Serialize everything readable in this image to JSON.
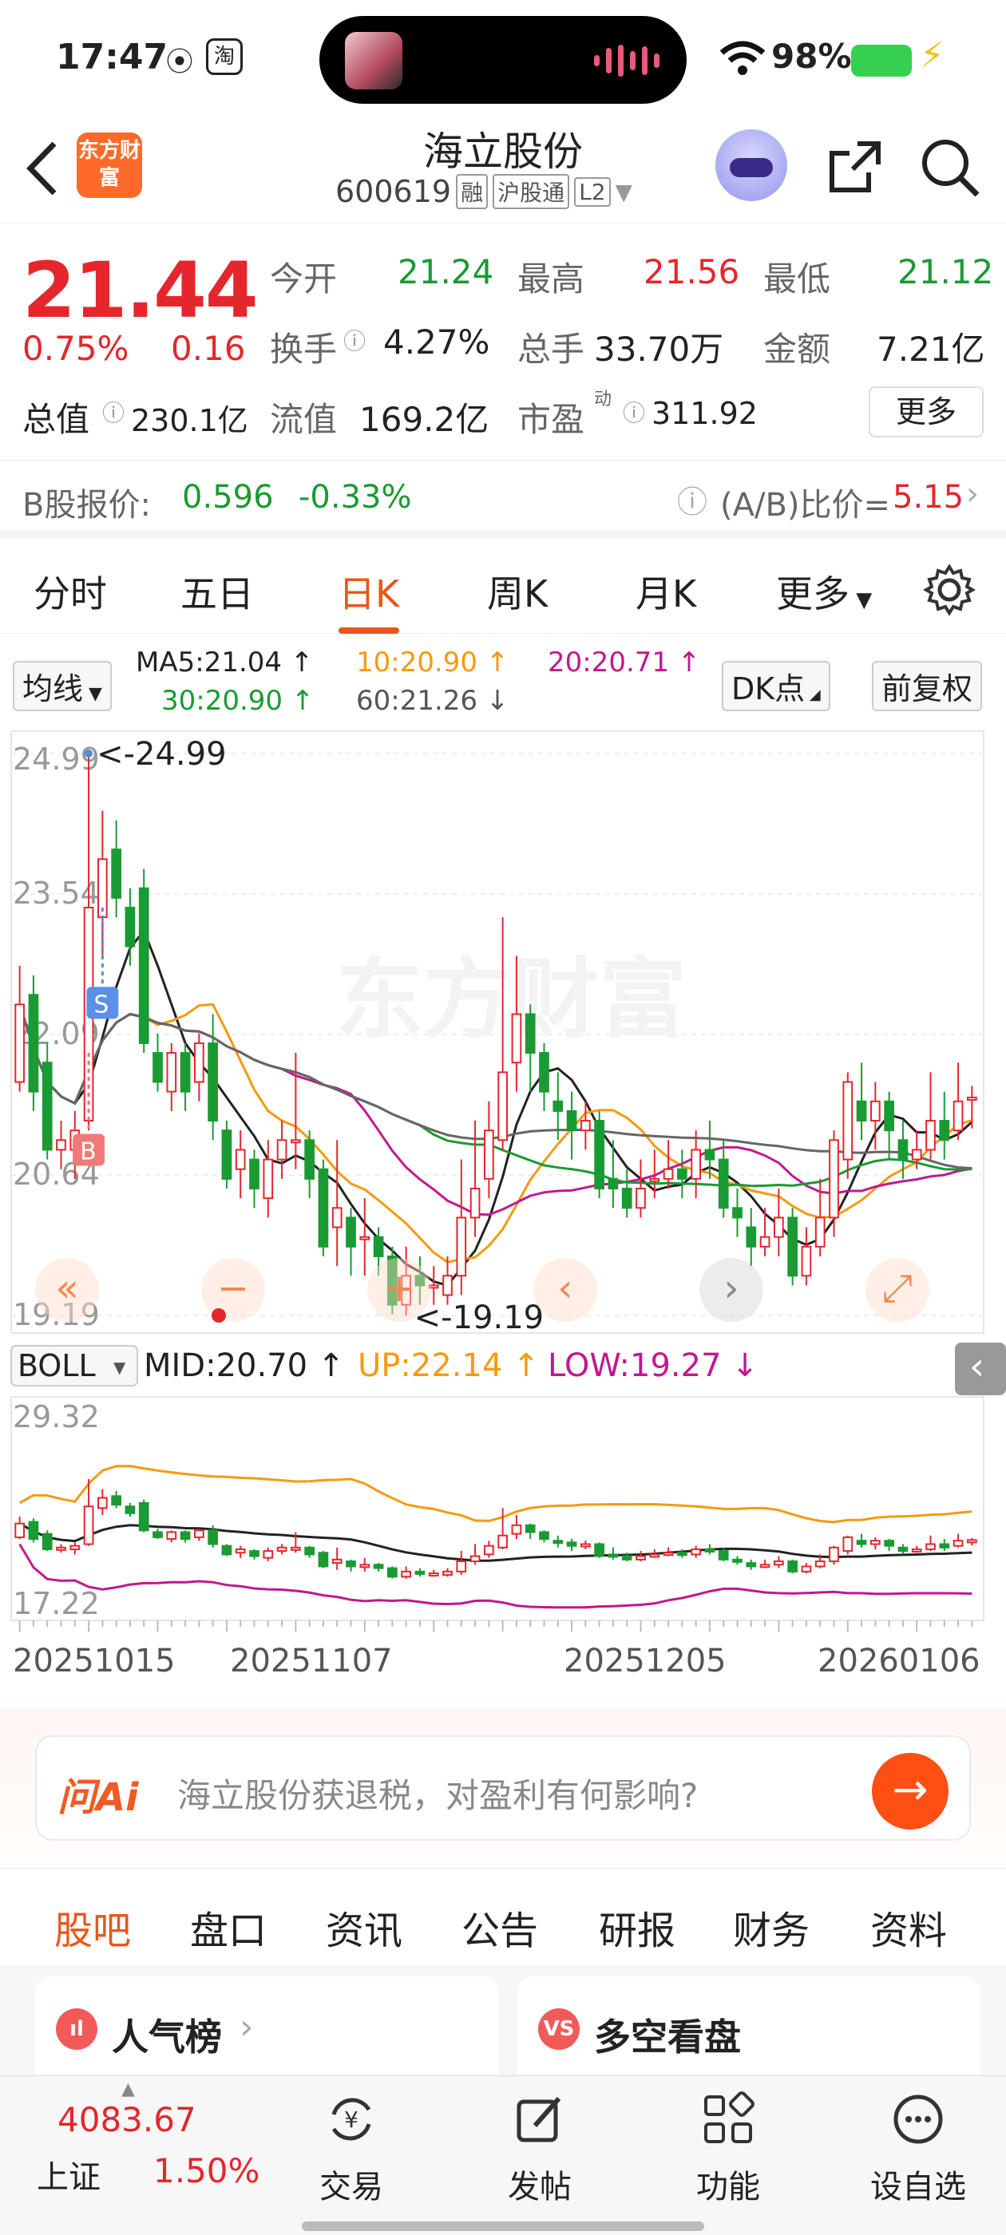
{
  "status_bar": {
    "time": "17:47",
    "battery": "98%"
  },
  "header": {
    "logo": "东方财富",
    "title": "海立股份",
    "code": "600619",
    "tags": [
      "融",
      "沪股通",
      "L2"
    ]
  },
  "quote": {
    "price": "21.44",
    "change_pct": "0.75%",
    "change": "0.16",
    "open_label": "今开",
    "open": "21.24",
    "high_label": "最高",
    "high": "21.56",
    "low_label": "最低",
    "low": "21.12",
    "turnover_label": "换手",
    "turnover": "4.27%",
    "volume_label": "总手",
    "volume": "33.70万",
    "amount_label": "金额",
    "amount": "7.21亿",
    "mktcap_label": "总值",
    "mktcap": "230.1亿",
    "float_label": "流值",
    "float": "169.2亿",
    "pe_label": "市盈",
    "pe_sup": "动",
    "pe": "311.92",
    "more": "更多"
  },
  "b_quote": {
    "label": "B股报价:",
    "price": "0.596",
    "change": "-0.33%",
    "ratio_label": "(A/B)比价=",
    "ratio": "5.15"
  },
  "ktabs": [
    "分时",
    "五日",
    "日K",
    "周K",
    "月K",
    "更多"
  ],
  "ma_row": {
    "selector": "均线",
    "ma5": "MA5:21.04 ↑",
    "ma10": "10:20.90 ↑",
    "ma20": "20:20.71 ↑",
    "ma30": "30:20.90 ↑",
    "ma60": "60:21.26 ↓",
    "dk": "DK点",
    "adjust": "前复权"
  },
  "boll_row": {
    "selector": "BOLL",
    "mid": "MID:20.70 ↑",
    "up": "UP:22.14 ↑",
    "low": "LOW:19.27 ↓"
  },
  "chart_data": {
    "type": "candlestick",
    "y_ticks": [
      "24.99",
      "23.54",
      "22.09",
      "20.64",
      "19.19"
    ],
    "ylim": [
      19.19,
      24.99
    ],
    "max_label": "<-24.99",
    "min_label": "<-19.19",
    "signal_sell": "S",
    "signal_buy": "B",
    "boll_ticks": [
      "29.32",
      "17.22"
    ],
    "x_ticks": [
      "20251015",
      "20251107",
      "20251205",
      "20260106"
    ],
    "candles": [
      [
        21.6,
        22.4,
        22.8,
        21.5
      ],
      [
        22.5,
        21.5,
        22.7,
        21.3
      ],
      [
        21.8,
        20.9,
        22.0,
        20.8
      ],
      [
        20.9,
        21.0,
        21.2,
        20.7
      ],
      [
        20.9,
        21.1,
        21.3,
        20.6
      ],
      [
        21.2,
        23.4,
        24.99,
        21.1
      ],
      [
        23.3,
        23.9,
        24.4,
        22.9
      ],
      [
        24.0,
        23.5,
        24.3,
        23.3
      ],
      [
        23.4,
        23.0,
        23.6,
        22.8
      ],
      [
        23.6,
        22.0,
        23.8,
        21.9
      ],
      [
        21.9,
        21.6,
        22.1,
        21.5
      ],
      [
        21.5,
        21.9,
        22.0,
        21.3
      ],
      [
        21.9,
        21.5,
        22.0,
        21.3
      ],
      [
        21.6,
        22.0,
        22.1,
        21.4
      ],
      [
        22.0,
        21.2,
        22.3,
        21.0
      ],
      [
        21.1,
        20.6,
        21.2,
        20.5
      ],
      [
        20.7,
        20.9,
        21.1,
        20.4
      ],
      [
        20.8,
        20.5,
        20.9,
        20.3
      ],
      [
        20.4,
        20.8,
        21.0,
        20.2
      ],
      [
        20.8,
        21.0,
        21.2,
        20.6
      ],
      [
        21.0,
        21.0,
        21.9,
        20.7
      ],
      [
        21.0,
        20.6,
        21.1,
        20.4
      ],
      [
        20.7,
        19.9,
        20.8,
        19.8
      ],
      [
        20.1,
        20.3,
        21.0,
        19.7
      ],
      [
        20.2,
        19.9,
        20.3,
        19.6
      ],
      [
        20.0,
        20.0,
        20.4,
        19.6
      ],
      [
        20.0,
        19.8,
        20.1,
        19.6
      ],
      [
        19.8,
        19.3,
        19.9,
        19.2
      ],
      [
        19.3,
        19.6,
        19.9,
        19.19
      ],
      [
        19.6,
        19.5,
        19.8,
        19.3
      ],
      [
        19.5,
        19.5,
        19.7,
        19.3
      ],
      [
        19.4,
        19.6,
        19.8,
        19.3
      ],
      [
        19.6,
        20.2,
        20.8,
        19.4
      ],
      [
        20.2,
        20.5,
        21.2,
        20.0
      ],
      [
        20.6,
        21.1,
        21.4,
        20.4
      ],
      [
        21.0,
        21.7,
        23.3,
        20.9
      ],
      [
        21.8,
        22.3,
        22.9,
        21.5
      ],
      [
        22.3,
        21.9,
        22.4,
        21.5
      ],
      [
        21.9,
        21.5,
        22.0,
        21.3
      ],
      [
        21.4,
        21.3,
        21.7,
        21.0
      ],
      [
        21.3,
        21.1,
        21.5,
        20.8
      ],
      [
        21.1,
        21.2,
        21.4,
        20.9
      ],
      [
        21.2,
        20.5,
        21.3,
        20.4
      ],
      [
        20.6,
        20.5,
        21.0,
        20.3
      ],
      [
        20.5,
        20.3,
        20.7,
        20.2
      ],
      [
        20.3,
        20.5,
        20.8,
        20.2
      ],
      [
        20.6,
        20.6,
        20.9,
        20.4
      ],
      [
        20.6,
        20.7,
        21.0,
        20.5
      ],
      [
        20.7,
        20.6,
        20.9,
        20.4
      ],
      [
        20.6,
        20.9,
        21.1,
        20.4
      ],
      [
        20.9,
        20.8,
        21.2,
        20.6
      ],
      [
        20.8,
        20.3,
        21.0,
        20.2
      ],
      [
        20.3,
        20.2,
        20.5,
        20.0
      ],
      [
        20.1,
        19.9,
        20.3,
        19.7
      ],
      [
        19.9,
        20.0,
        20.3,
        19.8
      ],
      [
        20.0,
        20.2,
        20.5,
        19.8
      ],
      [
        20.2,
        19.6,
        20.3,
        19.5
      ],
      [
        19.6,
        19.9,
        20.1,
        19.5
      ],
      [
        19.9,
        20.2,
        20.6,
        19.8
      ],
      [
        20.2,
        21.0,
        21.1,
        20.0
      ],
      [
        20.8,
        21.6,
        21.7,
        20.6
      ],
      [
        21.4,
        21.2,
        21.8,
        21.0
      ],
      [
        21.2,
        21.4,
        21.6,
        20.9
      ],
      [
        21.4,
        21.1,
        21.5,
        20.8
      ],
      [
        21.0,
        20.8,
        21.2,
        20.6
      ],
      [
        20.8,
        20.9,
        21.1,
        20.7
      ],
      [
        20.9,
        21.2,
        21.7,
        20.8
      ],
      [
        21.2,
        21.0,
        21.5,
        20.8
      ],
      [
        21.1,
        21.4,
        21.8,
        21.0
      ],
      [
        21.44,
        21.44,
        21.56,
        21.12
      ]
    ]
  },
  "ai_bar": {
    "logo": "问Ai",
    "question": "海立股份获退税，对盈利有何影响?"
  },
  "section_tabs": [
    "股吧",
    "盘口",
    "资讯",
    "公告",
    "研报",
    "财务",
    "资料"
  ],
  "cards": [
    {
      "icon": "ıl",
      "title": "人气榜"
    },
    {
      "icon": "VS",
      "title": "多空看盘"
    }
  ],
  "index": {
    "value": "4083.67",
    "name": "上证",
    "change": "1.50%"
  },
  "bottom_nav": [
    "交易",
    "发帖",
    "功能",
    "设自选"
  ],
  "colors": {
    "up": "#e4262d",
    "down": "#1a9a33",
    "accent": "#e8561c"
  }
}
